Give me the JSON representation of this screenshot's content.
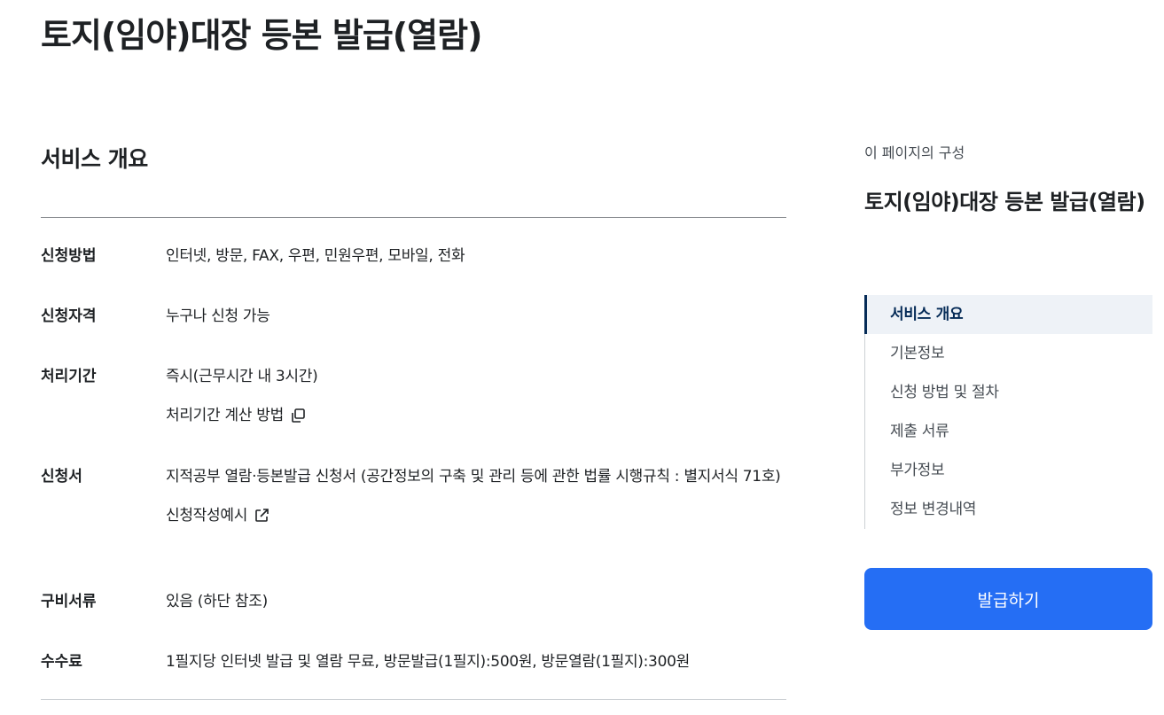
{
  "page": {
    "title": "토지(임야)대장 등본 발급(열람)"
  },
  "overview": {
    "section_title": "서비스 개요",
    "rows": [
      {
        "label": "신청방법",
        "value": "인터넷, 방문, FAX, 우편, 민원우편, 모바일, 전화"
      },
      {
        "label": "신청자격",
        "value": "누구나 신청 가능"
      },
      {
        "label": "처리기간",
        "value": "즉시(근무시간 내 3시간)",
        "link": "처리기간 계산 방법",
        "link_icon": "copy-icon"
      },
      {
        "label": "신청서",
        "value": "지적공부 열람·등본발급 신청서 (공간정보의 구축 및 관리 등에 관한 법률 시행규칙 : 별지서식 71호)",
        "link": "신청작성예시",
        "link_icon": "external-link-icon"
      },
      {
        "label": "구비서류",
        "value": "있음 (하단 참조)"
      },
      {
        "label": "수수료",
        "value": "1필지당 인터넷 발급 및 열람 무료, 방문발급(1필지):500원, 방문열람(1필지):300원"
      }
    ]
  },
  "aside": {
    "caption": "이 페이지의 구성",
    "title": "토지(임야)대장 등본 발급(열람)",
    "toc": [
      {
        "label": "서비스 개요",
        "active": true
      },
      {
        "label": "기본정보"
      },
      {
        "label": "신청 방법 및 절차"
      },
      {
        "label": "제출 서류"
      },
      {
        "label": "부가정보"
      },
      {
        "label": "정보 변경내역"
      }
    ],
    "button_label": "발급하기"
  },
  "colors": {
    "primary": "#256ef4",
    "toc_active": "#052b57",
    "toc_active_bg": "#eef2f7"
  }
}
